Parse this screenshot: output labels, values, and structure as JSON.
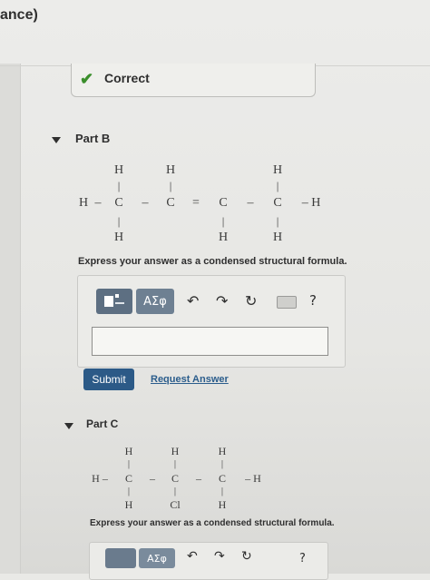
{
  "header": {
    "fragment": "ance)"
  },
  "correct": {
    "label": "Correct",
    "check": "✔"
  },
  "part_b": {
    "title": "Part B",
    "atoms": {
      "h_top_1": "H",
      "h_top_2": "H",
      "h_top_4": "H",
      "h_left": "H",
      "dash_left": "–",
      "c1": "C",
      "c2": "C",
      "c3": "C",
      "c4": "C",
      "bond_12": "–",
      "bond_23": "=",
      "bond_34": "–",
      "h_right": "– H",
      "v_top_1": "|",
      "v_top_2": "|",
      "v_top_4": "|",
      "v_bot_1": "|",
      "v_bot_3": "|",
      "v_bot_4": "|",
      "h_bot_1": "H",
      "h_bot_3": "H",
      "h_bot_4": "H"
    },
    "prompt": "Express your answer as a condensed structural formula.",
    "toolbar": {
      "symbols_label": "ΑΣφ",
      "undo": "↶",
      "redo": "↷",
      "reset": "↻",
      "help": "?"
    },
    "answer_value": "",
    "submit_label": "Submit",
    "request_label": "Request Answer"
  },
  "part_c": {
    "title": "Part C",
    "atoms": {
      "h_top_1": "H",
      "h_top_2": "H",
      "h_top_3": "H",
      "h_left": "H –",
      "c1": "C",
      "c2": "C",
      "c3": "C",
      "bond_12": "–",
      "bond_23": "–",
      "h_right": "– H",
      "v_top_1": "|",
      "v_top_2": "|",
      "v_top_3": "|",
      "v_bot_1": "|",
      "v_bot_2": "|",
      "v_bot_3": "|",
      "h_bot_1": "H",
      "cl_bot_2": "Cl",
      "h_bot_3": "H"
    },
    "prompt": "Express your answer as a condensed structural formula.",
    "toolbar": {
      "symbols_label": "ΑΣφ",
      "undo": "↶",
      "redo": "↷",
      "reset": "↻",
      "help": "?"
    }
  }
}
